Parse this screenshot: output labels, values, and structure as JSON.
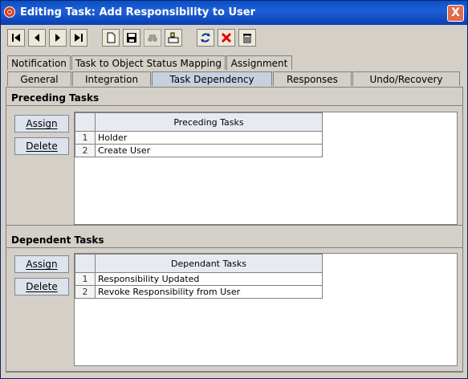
{
  "window": {
    "title": "Editing Task: Add Responsibility to User",
    "close_label": "X"
  },
  "toolbar": {
    "buttons": [
      {
        "name": "first-record-icon"
      },
      {
        "name": "previous-record-icon"
      },
      {
        "name": "next-record-icon"
      },
      {
        "name": "last-record-icon"
      },
      {
        "name": "new-document-icon"
      },
      {
        "name": "save-icon"
      },
      {
        "name": "find-icon"
      },
      {
        "name": "edit-icon"
      },
      {
        "name": "refresh-icon"
      },
      {
        "name": "delete-x-icon"
      },
      {
        "name": "trash-icon"
      }
    ]
  },
  "tabs": {
    "row1": [
      "Notification",
      "Task to Object Status Mapping",
      "Assignment"
    ],
    "row2": [
      "General",
      "Integration",
      "Task Dependency",
      "Responses",
      "Undo/Recovery"
    ],
    "active": "Task Dependency"
  },
  "preceding": {
    "section_title": "Preceding Tasks",
    "assign_label": "Assign",
    "assign_mnemonic": "A",
    "delete_label": "Delete",
    "delete_mnemonic": "D",
    "column_header": "Preceding Tasks",
    "rows": [
      {
        "index": "1",
        "value": "Holder"
      },
      {
        "index": "2",
        "value": "Create User"
      }
    ]
  },
  "dependent": {
    "section_title": "Dependent Tasks",
    "assign_label": "Assign",
    "delete_label": "Delete",
    "column_header": "Dependant Tasks",
    "rows": [
      {
        "index": "1",
        "value": "Responsibility Updated"
      },
      {
        "index": "2",
        "value": "Revoke Responsibility from User"
      }
    ]
  }
}
